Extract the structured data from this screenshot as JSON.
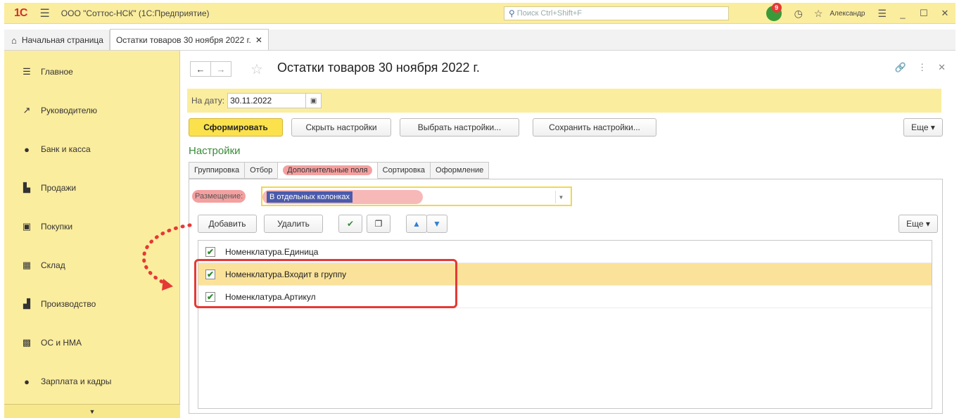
{
  "titlebar": {
    "logo": "1С",
    "title": "ООО \"Соттос-НСК\"  (1С:Предприятие)",
    "search_placeholder": "Поиск Ctrl+Shift+F",
    "notif_count": "9",
    "user": "Александр"
  },
  "tabs": {
    "home": "Начальная страница",
    "active": "Остатки товаров 30 ноября 2022 г."
  },
  "sidebar": {
    "items": [
      {
        "label": "Главное",
        "icon": "menu-icon"
      },
      {
        "label": "Руководителю",
        "icon": "chart-icon"
      },
      {
        "label": "Банк и касса",
        "icon": "coin-icon"
      },
      {
        "label": "Продажи",
        "icon": "bag-icon"
      },
      {
        "label": "Покупки",
        "icon": "cart-icon"
      },
      {
        "label": "Склад",
        "icon": "warehouse-icon"
      },
      {
        "label": "Производство",
        "icon": "factory-icon"
      },
      {
        "label": "ОС и НМА",
        "icon": "truck-icon"
      },
      {
        "label": "Зарплата и кадры",
        "icon": "person-icon"
      }
    ]
  },
  "document": {
    "title": "Остатки товаров 30 ноября 2022 г.",
    "date_label": "На дату:",
    "date_value": "30.11.2022"
  },
  "commands": {
    "generate": "Сформировать",
    "hide_settings": "Скрыть настройки",
    "choose_settings": "Выбрать настройки...",
    "save_settings": "Сохранить настройки...",
    "more": "Еще ▾"
  },
  "settings": {
    "caption": "Настройки",
    "tabs": [
      "Группировка",
      "Отбор",
      "Дополнительные поля",
      "Сортировка",
      "Оформление"
    ],
    "placement_label": "Размещение:",
    "placement_value": "В отдельных колонках"
  },
  "list_commands": {
    "add": "Добавить",
    "delete": "Удалить",
    "more": "Еще ▾"
  },
  "fields": [
    {
      "label": "Номенклатура.Единица",
      "checked": true
    },
    {
      "label": "Номенклатура.Входит в группу",
      "checked": true
    },
    {
      "label": "Номенклатура.Артикул",
      "checked": true
    }
  ],
  "colors": {
    "accent_yellow": "#fbed9e",
    "primary_button": "#fbe24d",
    "highlight_red": "#e53935",
    "settings_green": "#3a8a3a"
  }
}
